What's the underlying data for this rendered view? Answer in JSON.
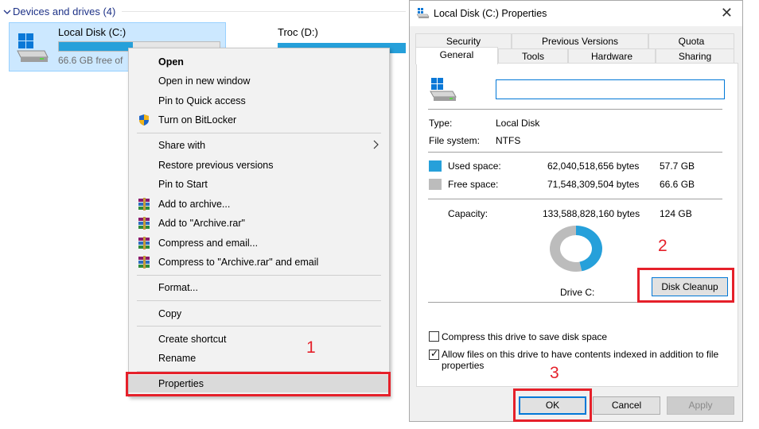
{
  "explorer": {
    "section_header": "Devices and drives (4)",
    "drives": [
      {
        "name": "Local Disk (C:)",
        "free_text": "66.6 GB free of",
        "used_fraction": 0.46
      },
      {
        "name": "Troc (D:)"
      }
    ]
  },
  "context_menu": {
    "items": [
      {
        "label": "Open",
        "bold": true
      },
      {
        "label": "Open in new window"
      },
      {
        "label": "Pin to Quick access"
      },
      {
        "label": "Turn on BitLocker",
        "icon": "shield-icon"
      },
      {
        "label": "Share with",
        "submenu": true
      },
      {
        "label": "Restore previous versions"
      },
      {
        "label": "Pin to Start"
      },
      {
        "label": "Add to archive...",
        "icon": "winrar-icon"
      },
      {
        "label": "Add to \"Archive.rar\"",
        "icon": "winrar-icon"
      },
      {
        "label": "Compress and email...",
        "icon": "winrar-icon"
      },
      {
        "label": "Compress to \"Archive.rar\" and email",
        "icon": "winrar-icon"
      },
      {
        "label": "Format..."
      },
      {
        "label": "Copy"
      },
      {
        "label": "Create shortcut"
      },
      {
        "label": "Rename"
      },
      {
        "label": "Properties",
        "highlighted": true
      }
    ]
  },
  "annotations": {
    "step1": "1",
    "step2": "2",
    "step3": "3",
    "color": "#e5202a"
  },
  "dialog": {
    "title": "Local Disk (C:) Properties",
    "close_glyph": "✕",
    "tabs_row1": [
      "Security",
      "Previous Versions",
      "Quota"
    ],
    "tabs_row2": [
      "General",
      "Tools",
      "Hardware",
      "Sharing"
    ],
    "active_tab": "General",
    "volume_label_value": "",
    "type_label": "Type:",
    "type_value": "Local Disk",
    "fs_label": "File system:",
    "fs_value": "NTFS",
    "used_label": "Used space:",
    "used_bytes": "62,040,518,656 bytes",
    "used_gb": "57.7 GB",
    "free_label": "Free space:",
    "free_bytes": "71,548,309,504 bytes",
    "free_gb": "66.6 GB",
    "capacity_label": "Capacity:",
    "capacity_bytes": "133,588,828,160 bytes",
    "capacity_gb": "124 GB",
    "drive_label": "Drive C:",
    "disk_cleanup": "Disk Cleanup",
    "compress_label": "Compress this drive to save disk space",
    "compress_checked": false,
    "index_label_line1": "Allow files on this drive to have contents indexed in addition to file",
    "index_label_line2": "properties",
    "index_checked": true,
    "ok": "OK",
    "cancel": "Cancel",
    "apply": "Apply",
    "used_fraction": 0.4644,
    "colors": {
      "used": "#26a0da",
      "free": "#bcbcbc"
    }
  }
}
